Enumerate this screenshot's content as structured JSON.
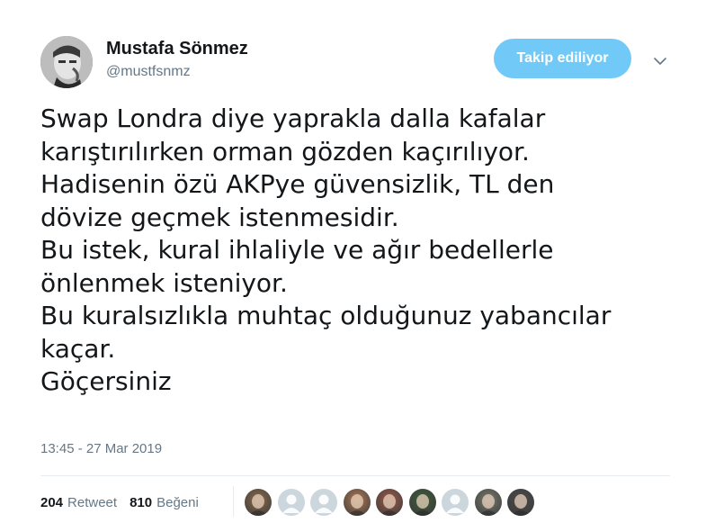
{
  "user": {
    "name": "Mustafa Sönmez",
    "handle": "@mustfsnmz"
  },
  "follow_button": {
    "label": "Takip ediliyor"
  },
  "tweet": {
    "text": "Swap Londra diye yaprakla dalla kafalar\nkarıştırılırken orman gözden kaçırılıyor.\nHadisenin özü AKPye güvensizlik, TL den\ndövize geçmek istenmesidir.\nBu istek, kural ihlaliyle ve ağır bedellerle\nönlenmek isteniyor.\nBu kuralsızlıkla muhtaç olduğunuz yabancılar\nkaçar.\nGöçersiniz",
    "timestamp": "13:45 - 27 Mar 2019"
  },
  "stats": {
    "retweets_count": "204",
    "retweets_label": "Retweet",
    "likes_count": "810",
    "likes_label": "Beğeni"
  },
  "likers": [
    {
      "kind": "photo",
      "color": "#8a6a4a"
    },
    {
      "kind": "default",
      "color": "#ccd6dd"
    },
    {
      "kind": "default",
      "color": "#ccd6dd"
    },
    {
      "kind": "photo",
      "color": "#b07a55"
    },
    {
      "kind": "photo",
      "color": "#9a5a4a"
    },
    {
      "kind": "photo",
      "color": "#3d5a3a"
    },
    {
      "kind": "default",
      "color": "#ccd6dd"
    },
    {
      "kind": "photo",
      "color": "#7a7a70"
    },
    {
      "kind": "photo",
      "color": "#4a4a4a"
    }
  ],
  "colors": {
    "accent": "#71c9f8",
    "text": "#14171a",
    "secondary": "#657786",
    "divider": "#e6ecf0"
  }
}
